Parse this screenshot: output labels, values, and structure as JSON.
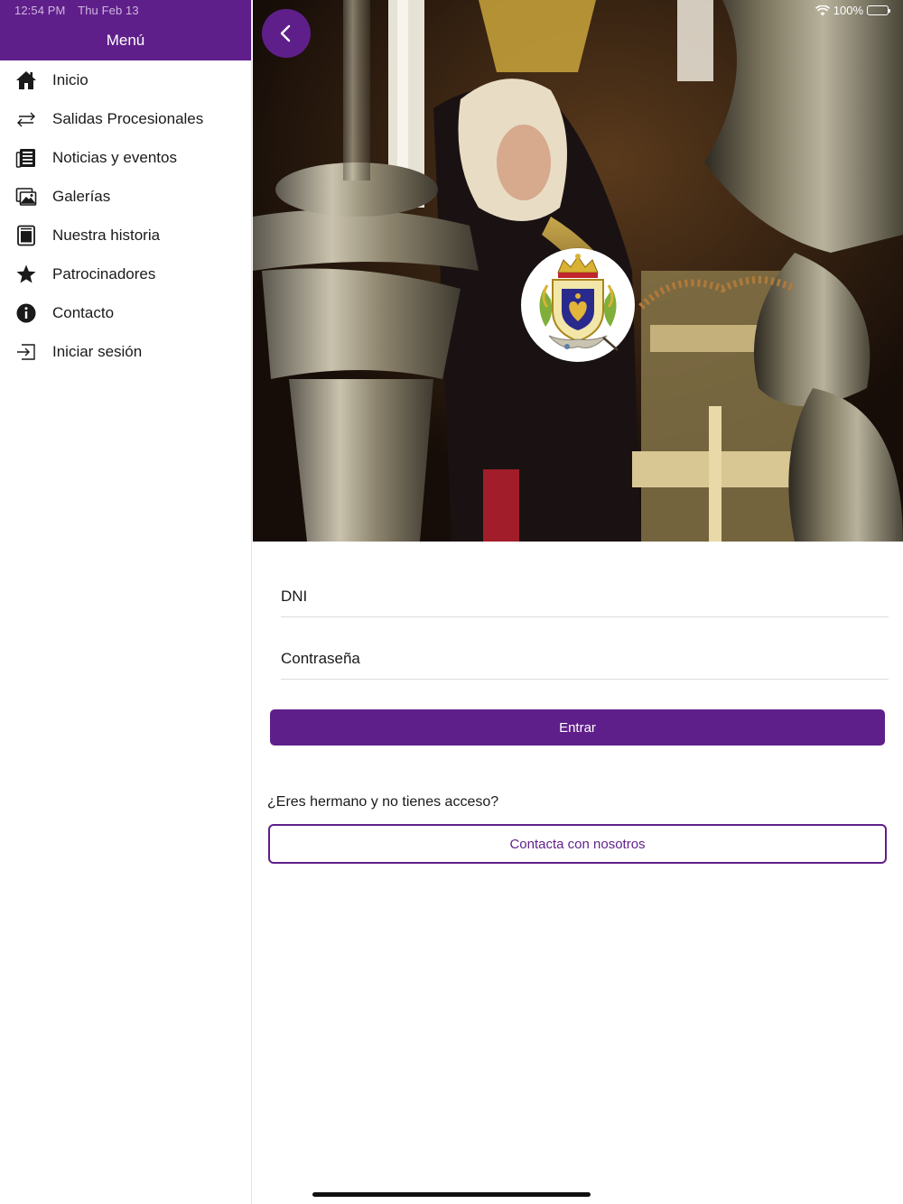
{
  "status_bar": {
    "time": "12:54 PM",
    "date": "Thu Feb 13",
    "battery": "100%"
  },
  "sidebar": {
    "title": "Menú",
    "items": [
      {
        "label": "Inicio",
        "icon": "home-icon"
      },
      {
        "label": "Salidas Procesionales",
        "icon": "arrows-swap-icon"
      },
      {
        "label": "Noticias y eventos",
        "icon": "newspaper-icon"
      },
      {
        "label": "Galerías",
        "icon": "gallery-icon"
      },
      {
        "label": "Nuestra historia",
        "icon": "book-icon"
      },
      {
        "label": "Patrocinadores",
        "icon": "star-icon"
      },
      {
        "label": "Contacto",
        "icon": "info-icon"
      },
      {
        "label": "Iniciar sesión",
        "icon": "login-icon"
      }
    ]
  },
  "login": {
    "dni_placeholder": "DNI",
    "password_placeholder": "Contraseña",
    "submit_label": "Entrar",
    "no_access_text": "¿Eres hermano y no tienes acceso?",
    "contact_label": "Contacta con nosotros"
  },
  "colors": {
    "accent": "#5f1f8a",
    "background": "#ffffff"
  }
}
